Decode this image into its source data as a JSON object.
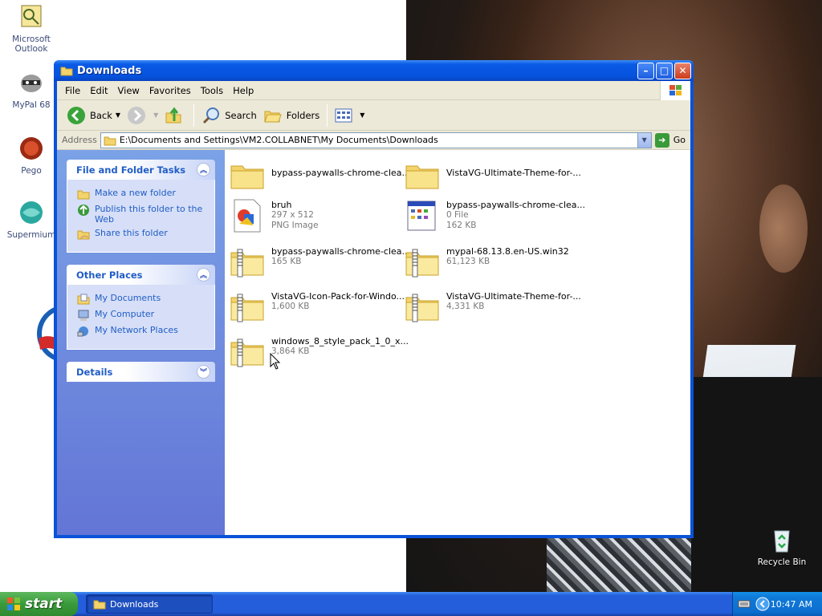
{
  "desktop": {
    "icons": [
      {
        "label": "Microsoft Outlook",
        "icon": "outlook-icon"
      },
      {
        "label": "MyPal 68",
        "icon": "raccoon-icon"
      },
      {
        "label": "Pego",
        "icon": "pego-icon"
      },
      {
        "label": "Supermium",
        "icon": "supermium-icon"
      },
      {
        "label": "Recycle Bin",
        "icon": "recycle-bin-icon"
      }
    ]
  },
  "window": {
    "title": "Downloads",
    "menus": [
      "File",
      "Edit",
      "View",
      "Favorites",
      "Tools",
      "Help"
    ],
    "toolbar": {
      "back_label": "Back",
      "search_label": "Search",
      "folders_label": "Folders"
    },
    "address": {
      "label": "Address",
      "value": "E:\\Documents and Settings\\VM2.COLLABNET\\My Documents\\Downloads",
      "go_label": "Go"
    },
    "taskpane": {
      "file_tasks": {
        "title": "File and Folder Tasks",
        "items": [
          "Make a new folder",
          "Publish this folder to the Web",
          "Share this folder"
        ]
      },
      "other_places": {
        "title": "Other Places",
        "items": [
          "My Documents",
          "My Computer",
          "My Network Places"
        ]
      },
      "details": {
        "title": "Details"
      }
    },
    "files": [
      {
        "name": "bypass-paywalls-chrome-clea...",
        "line1": "",
        "line2": "",
        "type": "folder"
      },
      {
        "name": "VistaVG-Ultimate-Theme-for-...",
        "line1": "",
        "line2": "",
        "type": "folder"
      },
      {
        "name": "bruh",
        "line1": "297 x 512",
        "line2": "PNG Image",
        "type": "png"
      },
      {
        "name": "bypass-paywalls-chrome-clea...",
        "line1": "0 File",
        "line2": "162 KB",
        "type": "file"
      },
      {
        "name": "bypass-paywalls-chrome-clea...",
        "line1": "165 KB",
        "line2": "",
        "type": "zip"
      },
      {
        "name": "mypal-68.13.8.en-US.win32",
        "line1": "61,123 KB",
        "line2": "",
        "type": "zip"
      },
      {
        "name": "VistaVG-Icon-Pack-for-Windo...",
        "line1": "1,600 KB",
        "line2": "",
        "type": "zip"
      },
      {
        "name": "VistaVG-Ultimate-Theme-for-...",
        "line1": "4,331 KB",
        "line2": "",
        "type": "zip"
      },
      {
        "name": "windows_8_style_pack_1_0_x...",
        "line1": "3,864 KB",
        "line2": "",
        "type": "zip"
      }
    ]
  },
  "taskbar": {
    "start_label": "start",
    "task_label": "Downloads",
    "clock": "10:47 AM"
  }
}
